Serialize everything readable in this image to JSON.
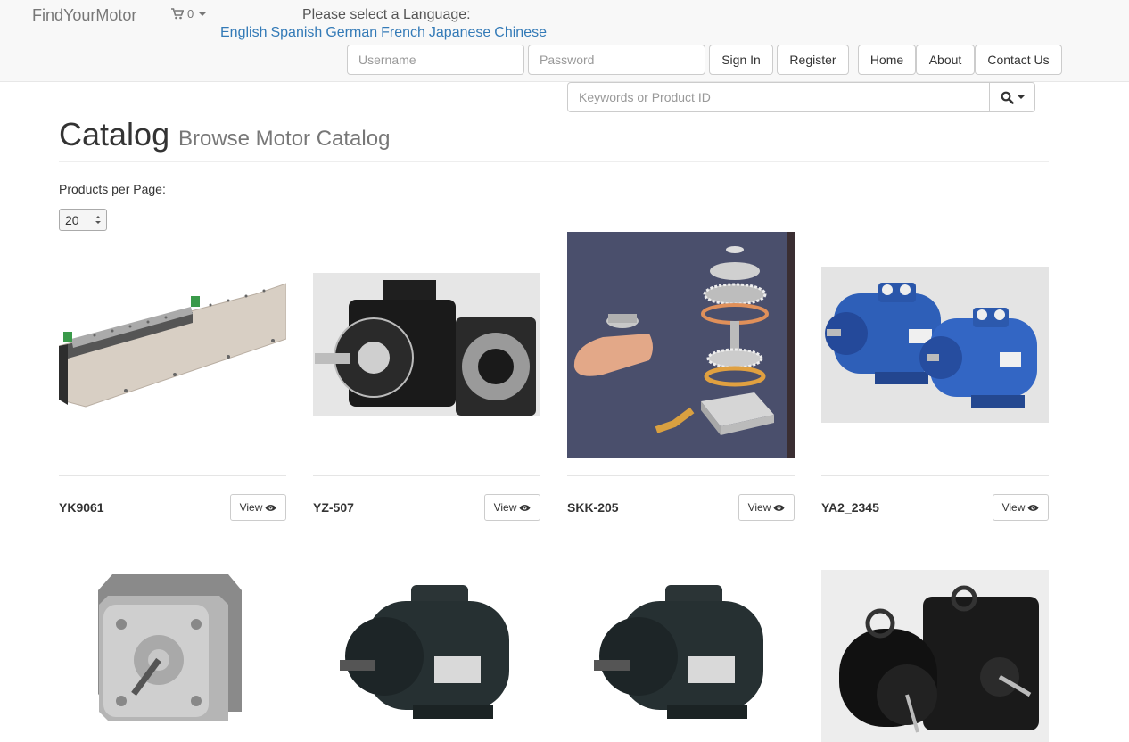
{
  "navbar": {
    "brand": "FindYourMotor",
    "cart_count": "0",
    "language_prompt": "Please select a Language:",
    "languages": [
      "English",
      "Spanish",
      "German",
      "French",
      "Japanese",
      "Chinese"
    ],
    "username_placeholder": "Username",
    "password_placeholder": "Password",
    "sign_in_label": "Sign In",
    "register_label": "Register",
    "home_label": "Home",
    "about_label": "About",
    "contact_label": "Contact Us"
  },
  "search": {
    "placeholder": "Keywords or Product ID",
    "icon": "search-icon"
  },
  "page": {
    "title": "Catalog",
    "subtitle": "Browse Motor Catalog"
  },
  "products_per_page": {
    "label": "Products per Page:",
    "value": "20"
  },
  "products": [
    {
      "name": "YK9061",
      "view_label": "View"
    },
    {
      "name": "YZ-507",
      "view_label": "View"
    },
    {
      "name": "SKK-205",
      "view_label": "View"
    },
    {
      "name": "YA2_2345",
      "view_label": "View"
    }
  ],
  "colors": {
    "link": "#337ab7",
    "navbar_bg": "#f8f8f8",
    "border": "#cccccc"
  }
}
